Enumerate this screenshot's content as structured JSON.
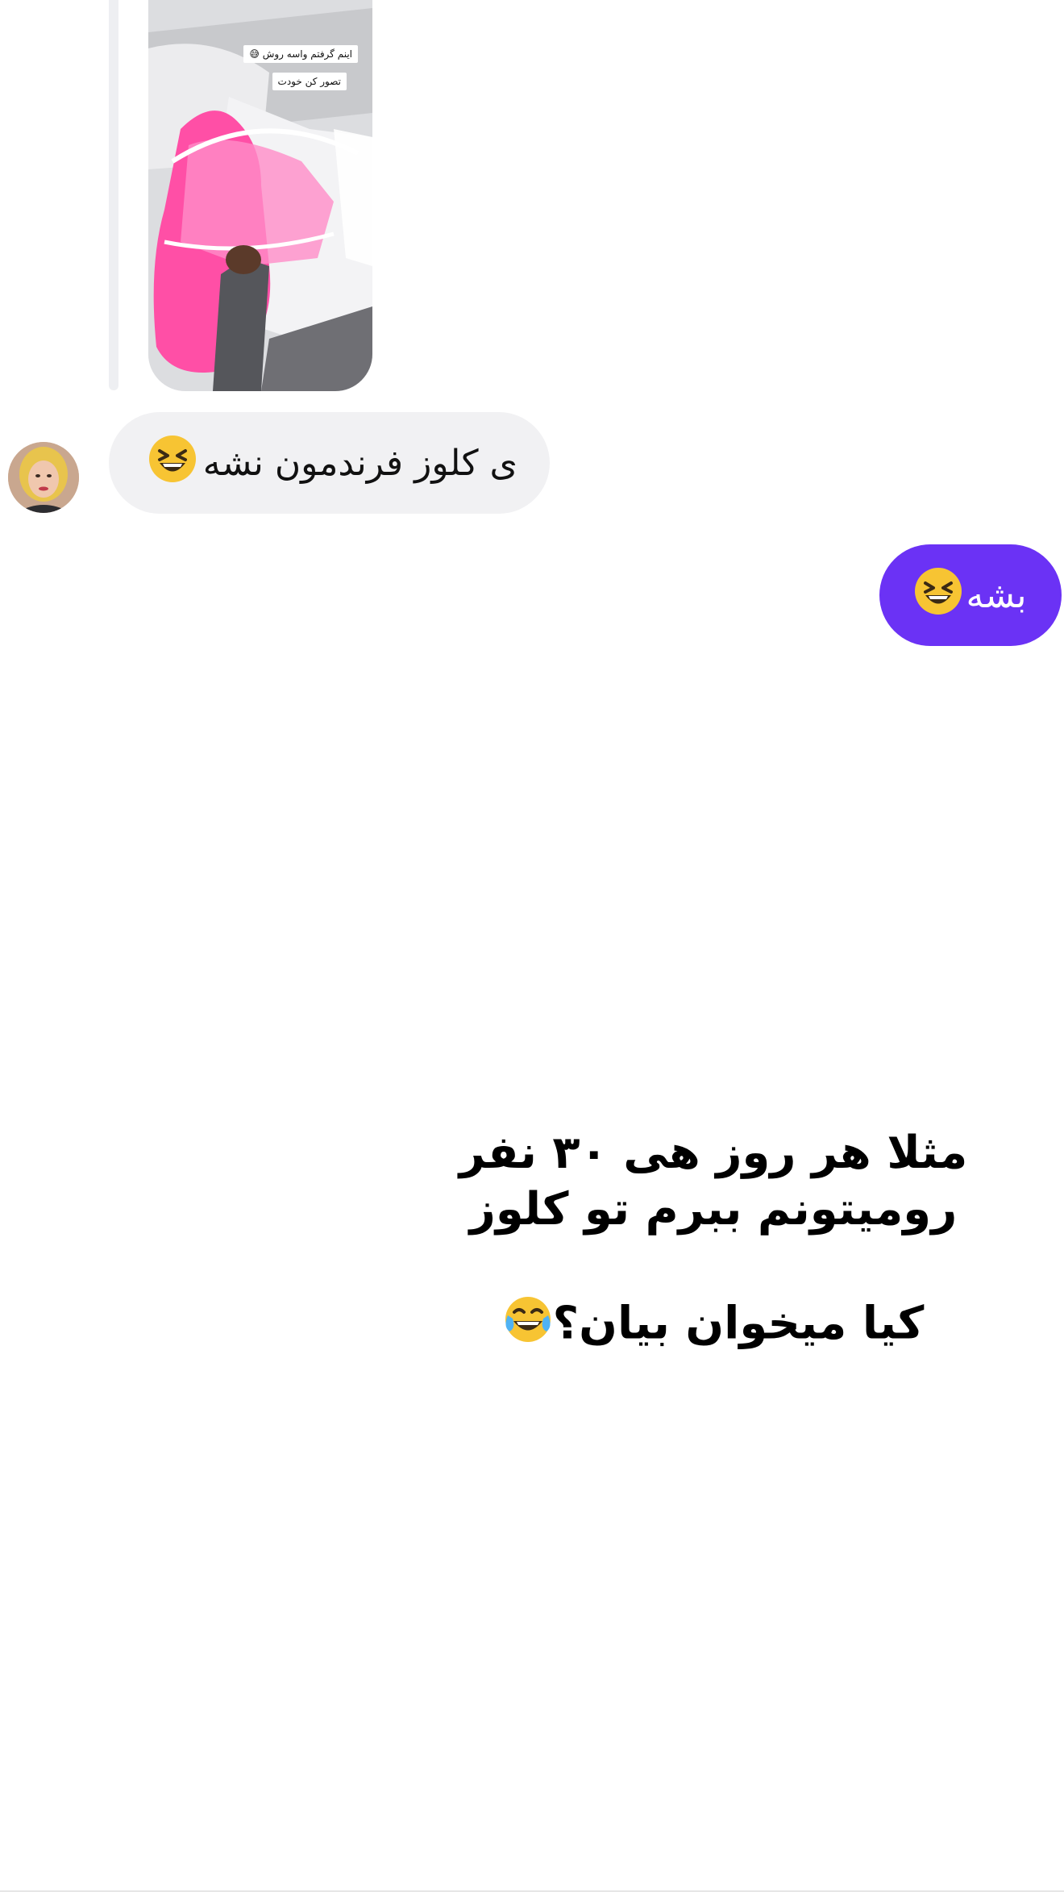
{
  "story_reply": {
    "caption_line1": "اینم گرفتم واسه روش 😅",
    "caption_line2": "تصور کن خودت"
  },
  "messages": [
    {
      "direction": "incoming",
      "text": "ی کلوز فرندمون نشه"
    },
    {
      "direction": "outgoing",
      "text": "بشه"
    }
  ],
  "overlay": {
    "line1": "مثلا هر روز هی ۳۰ نفر",
    "line2": "رومیتونم ببرم تو کلوز",
    "line3": "کیا میخوان بیان؟"
  },
  "colors": {
    "outgoing_bubble": "#6b32f5",
    "incoming_bubble": "#f1f1f3"
  },
  "icons": [
    "laughing-emoji",
    "tears-of-joy-emoji"
  ]
}
